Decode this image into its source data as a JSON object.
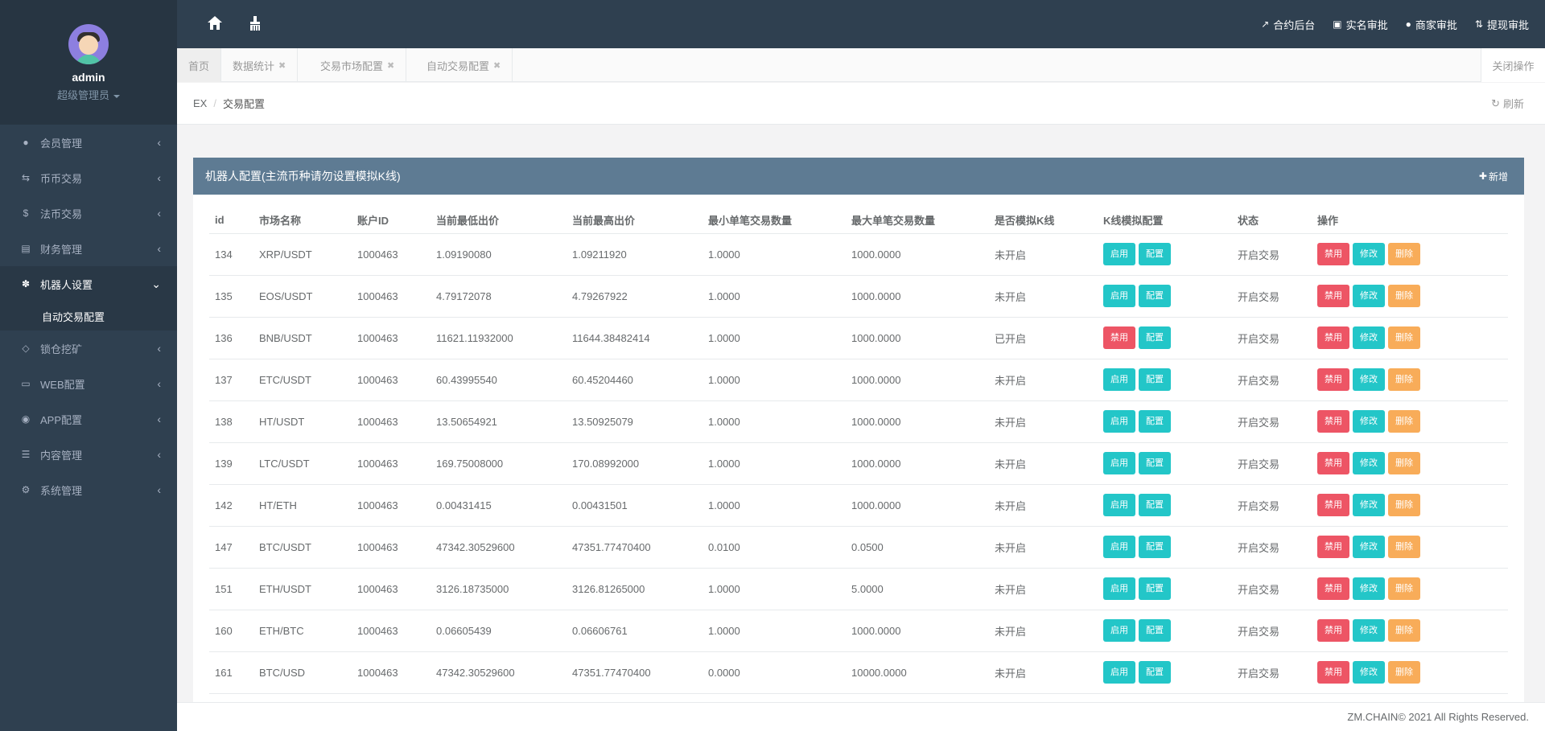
{
  "sidebar": {
    "user_name": "admin",
    "user_role": "超级管理员",
    "items": [
      {
        "label": "会员管理",
        "icon": "user-icon"
      },
      {
        "label": "币币交易",
        "icon": "exchange-icon"
      },
      {
        "label": "法币交易",
        "icon": "dollar-icon"
      },
      {
        "label": "财务管理",
        "icon": "money-icon"
      },
      {
        "label": "机器人设置",
        "icon": "paw-icon",
        "active": true
      },
      {
        "label": "锁仓挖矿",
        "icon": "diamond-icon"
      },
      {
        "label": "WEB配置",
        "icon": "laptop-icon"
      },
      {
        "label": "APP配置",
        "icon": "android-icon"
      },
      {
        "label": "内容管理",
        "icon": "list-icon"
      },
      {
        "label": "系统管理",
        "icon": "gears-icon"
      }
    ],
    "subitem": "自动交易配置"
  },
  "topbar": {
    "links": [
      "合约后台",
      "实名审批",
      "商家审批",
      "提现审批"
    ]
  },
  "tabs": {
    "home": "首页",
    "items": [
      "数据统计",
      "交易市场配置",
      "自动交易配置"
    ],
    "close_all": "关闭操作"
  },
  "breadcrumb": {
    "root": "EX",
    "current": "交易配置",
    "refresh": "刷新"
  },
  "panel": {
    "title": "机器人配置(主流币种请勿设置模拟K线)",
    "add_label": "新增"
  },
  "table": {
    "headers": [
      "id",
      "市场名称",
      "账户ID",
      "当前最低出价",
      "当前最高出价",
      "最小单笔交易数量",
      "最大单笔交易数量",
      "是否模拟K线",
      "K线模拟配置",
      "状态",
      "操作"
    ],
    "rows": [
      {
        "id": "134",
        "market": "XRP/USDT",
        "account": "1000463",
        "low": "1.09190080",
        "high": "1.09211920",
        "min": "1.0000",
        "max": "1000.0000",
        "kline": "未开启",
        "kline_on": false,
        "status": "开启交易"
      },
      {
        "id": "135",
        "market": "EOS/USDT",
        "account": "1000463",
        "low": "4.79172078",
        "high": "4.79267922",
        "min": "1.0000",
        "max": "1000.0000",
        "kline": "未开启",
        "kline_on": false,
        "status": "开启交易"
      },
      {
        "id": "136",
        "market": "BNB/USDT",
        "account": "1000463",
        "low": "11621.11932000",
        "high": "11644.38482414",
        "min": "1.0000",
        "max": "1000.0000",
        "kline": "已开启",
        "kline_on": true,
        "status": "开启交易"
      },
      {
        "id": "137",
        "market": "ETC/USDT",
        "account": "1000463",
        "low": "60.43995540",
        "high": "60.45204460",
        "min": "1.0000",
        "max": "1000.0000",
        "kline": "未开启",
        "kline_on": false,
        "status": "开启交易"
      },
      {
        "id": "138",
        "market": "HT/USDT",
        "account": "1000463",
        "low": "13.50654921",
        "high": "13.50925079",
        "min": "1.0000",
        "max": "1000.0000",
        "kline": "未开启",
        "kline_on": false,
        "status": "开启交易"
      },
      {
        "id": "139",
        "market": "LTC/USDT",
        "account": "1000463",
        "low": "169.75008000",
        "high": "170.08992000",
        "min": "1.0000",
        "max": "1000.0000",
        "kline": "未开启",
        "kline_on": false,
        "status": "开启交易"
      },
      {
        "id": "142",
        "market": "HT/ETH",
        "account": "1000463",
        "low": "0.00431415",
        "high": "0.00431501",
        "min": "1.0000",
        "max": "1000.0000",
        "kline": "未开启",
        "kline_on": false,
        "status": "开启交易"
      },
      {
        "id": "147",
        "market": "BTC/USDT",
        "account": "1000463",
        "low": "47342.30529600",
        "high": "47351.77470400",
        "min": "0.0100",
        "max": "0.0500",
        "kline": "未开启",
        "kline_on": false,
        "status": "开启交易"
      },
      {
        "id": "151",
        "market": "ETH/USDT",
        "account": "1000463",
        "low": "3126.18735000",
        "high": "3126.81265000",
        "min": "1.0000",
        "max": "5.0000",
        "kline": "未开启",
        "kline_on": false,
        "status": "开启交易"
      },
      {
        "id": "160",
        "market": "ETH/BTC",
        "account": "1000463",
        "low": "0.06605439",
        "high": "0.06606761",
        "min": "1.0000",
        "max": "1000.0000",
        "kline": "未开启",
        "kline_on": false,
        "status": "开启交易"
      },
      {
        "id": "161",
        "market": "BTC/USD",
        "account": "1000463",
        "low": "47342.30529600",
        "high": "47351.77470400",
        "min": "0.0000",
        "max": "10000.0000",
        "kline": "未开启",
        "kline_on": false,
        "status": "开启交易"
      }
    ],
    "btn_enable": "启用",
    "btn_disable": "禁用",
    "btn_config": "配置",
    "btn_edit": "修改",
    "btn_delete": "删除"
  },
  "footer": {
    "copyright": "ZM.CHAIN© 2021 All Rights Reserved."
  },
  "colors": {
    "sidebar": "#2f4050",
    "panel_header": "#5e7b93",
    "info": "#23c6c8",
    "danger": "#ed5565",
    "warning": "#f8ac59",
    "success": "#1ab394"
  }
}
